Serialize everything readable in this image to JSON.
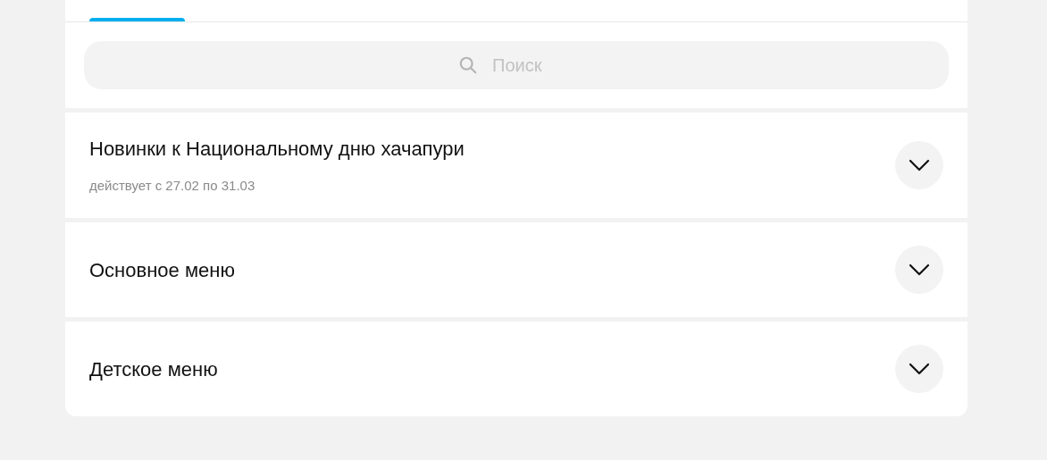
{
  "search": {
    "placeholder": "Поиск"
  },
  "sections": [
    {
      "title": "Новинки к Национальному дню хачапури",
      "subtitle": "действует с 27.02 по 31.03",
      "expanded": false
    },
    {
      "title": "Основное меню",
      "expanded": false
    },
    {
      "title": "Детское меню",
      "expanded": false
    }
  ]
}
